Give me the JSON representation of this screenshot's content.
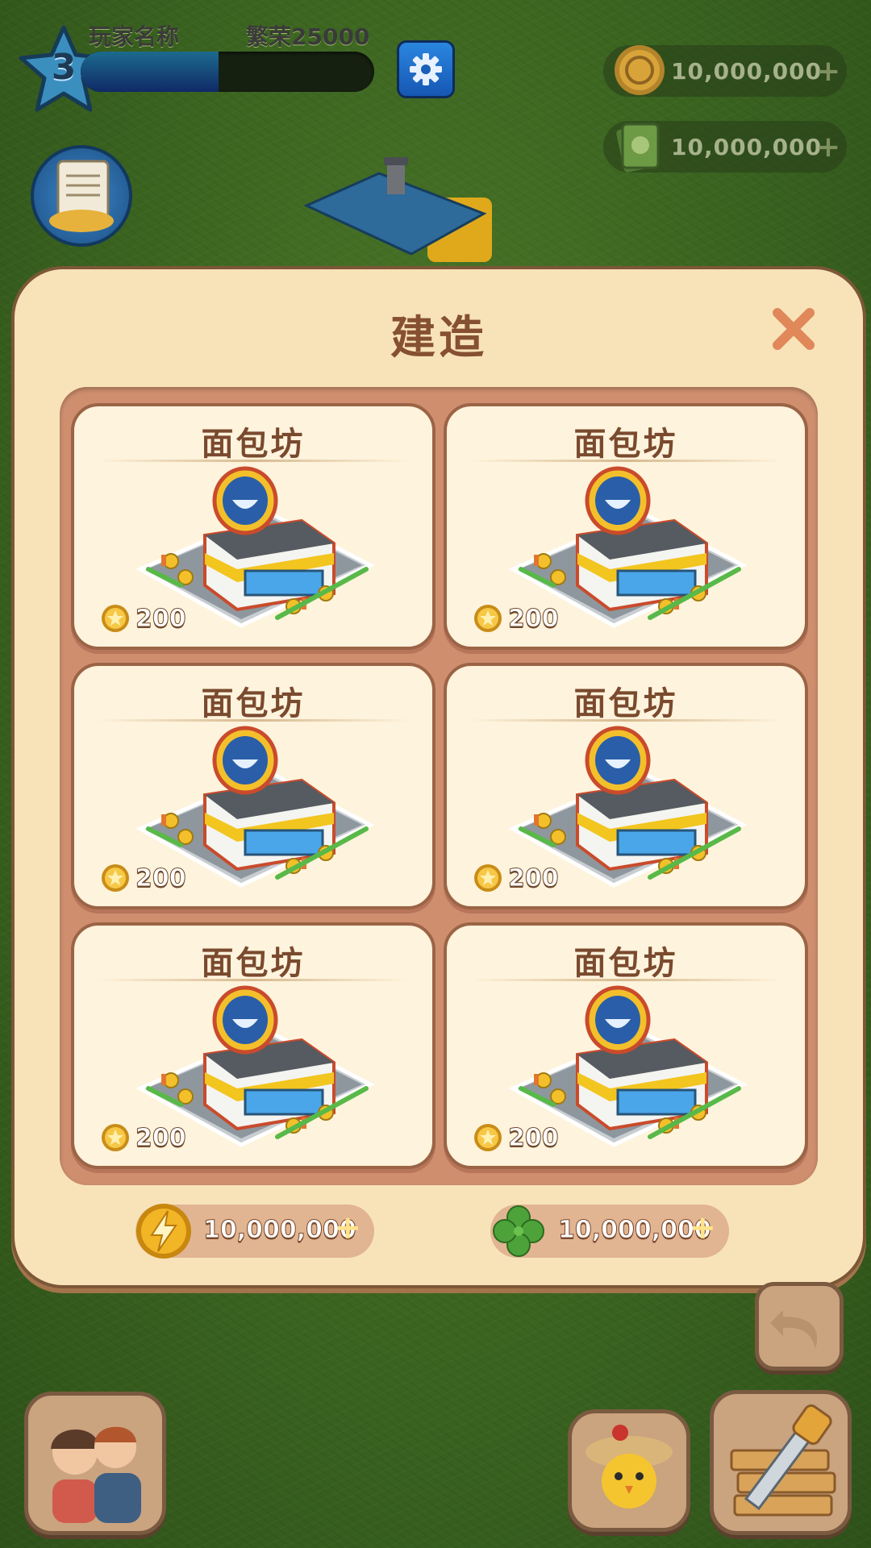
{
  "hud": {
    "level": "3",
    "player_name": "玩家名称",
    "prosperity": "繁荣25000",
    "xp_progress": 0.47,
    "coins": "10,000,000",
    "cash": "10,000,000",
    "plus": "+"
  },
  "dialog": {
    "title": "建造",
    "items": [
      {
        "name": "面包坊",
        "price": "200"
      },
      {
        "name": "面包坊",
        "price": "200"
      },
      {
        "name": "面包坊",
        "price": "200"
      },
      {
        "name": "面包坊",
        "price": "200"
      },
      {
        "name": "面包坊",
        "price": "200"
      },
      {
        "name": "面包坊",
        "price": "200"
      }
    ],
    "energy": "10,000,000",
    "clover": "10,000,000",
    "plus": "+"
  },
  "colors": {
    "dialog_bg": "#f8e3b9",
    "panel_bg": "#cf8f6f",
    "card_bg": "#fef3dc",
    "title_text": "#865032",
    "close": "#e0885a"
  },
  "icons": [
    "star-icon",
    "gear-icon",
    "coin-icon",
    "cash-icon",
    "scroll-icon",
    "close-icon",
    "lightning-coin-icon",
    "clover-icon",
    "undo-icon",
    "saw-icon"
  ]
}
